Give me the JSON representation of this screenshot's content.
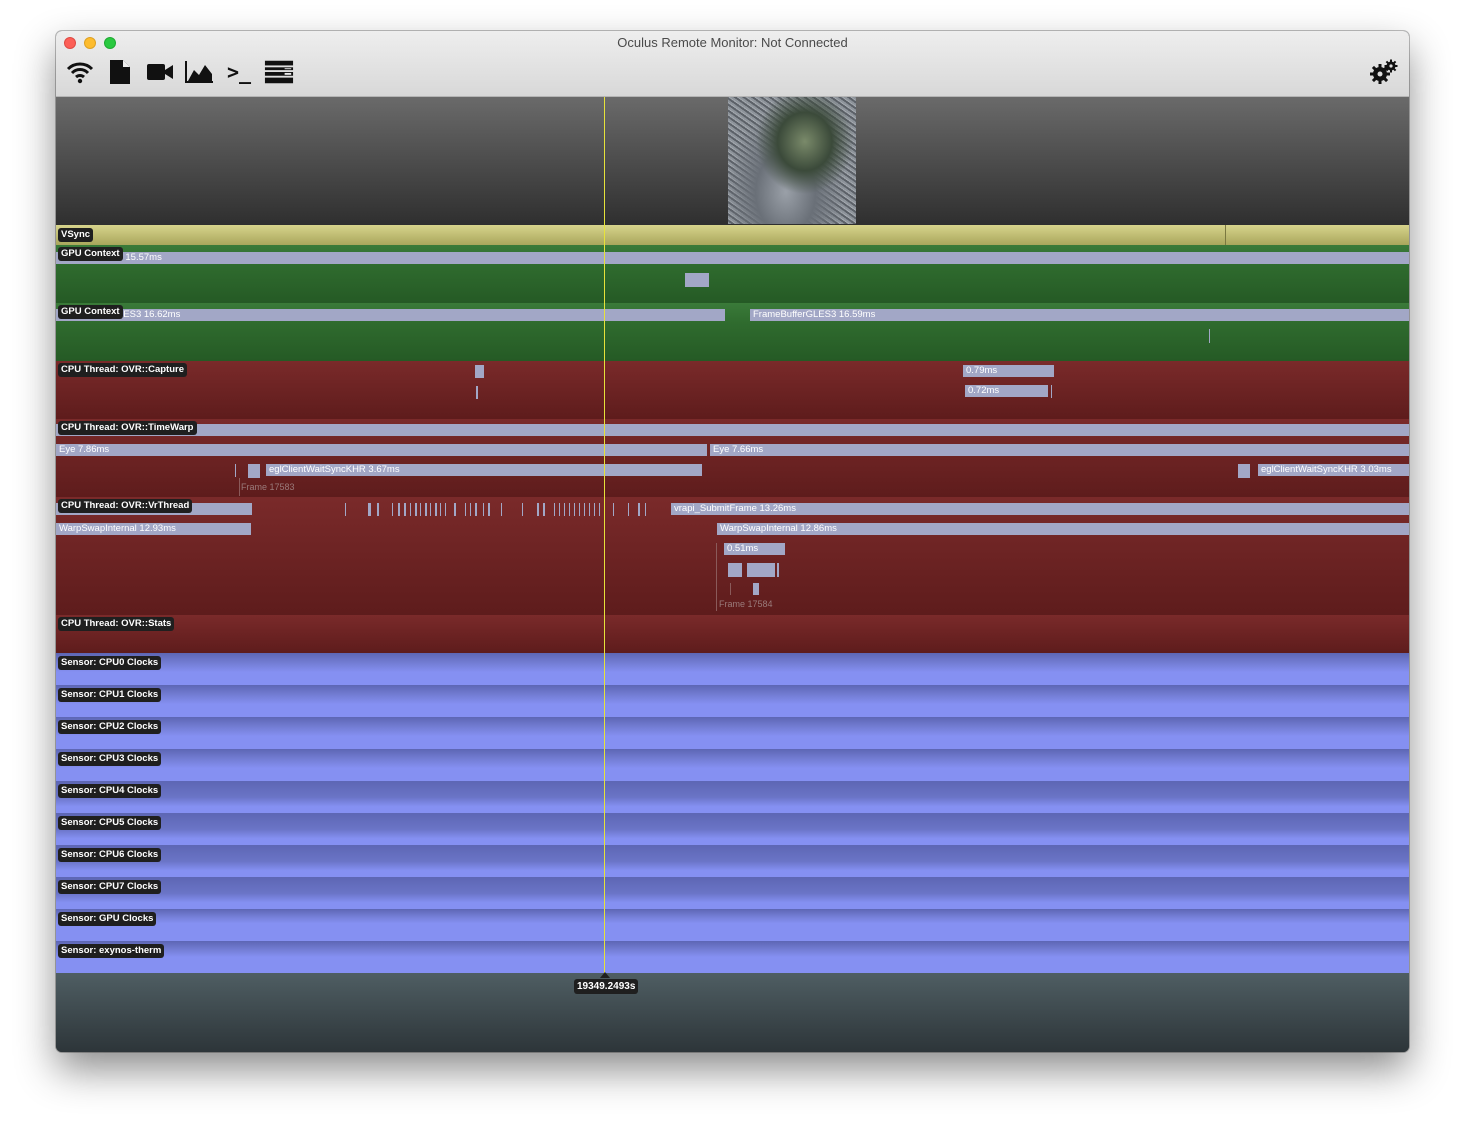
{
  "window": {
    "title": "Oculus Remote Monitor: Not Connected"
  },
  "toolbar": {
    "icons": [
      "wifi-icon",
      "document-icon",
      "video-camera-icon",
      "chart-area-icon",
      "terminal-icon",
      "list-panel-icon"
    ],
    "terminal_glyph": ">_",
    "settings_icon": "gears-icon"
  },
  "tracks": {
    "vsync": {
      "label": "VSync"
    },
    "gpu_context_1": {
      "label": "GPU Context",
      "bar": "s 15.57ms"
    },
    "gpu_context_2": {
      "label": "GPU Context",
      "bar1": "LES3 16.62ms",
      "bar2": "FrameBufferGLES3 16.59ms"
    },
    "capture": {
      "label": "CPU Thread: OVR::Capture",
      "bar1": "0.79ms",
      "bar2": "0.72ms"
    },
    "timewarp": {
      "label": "CPU Thread: OVR::TimeWarp",
      "eye1": "Eye 7.86ms",
      "eye2": "Eye 7.66ms",
      "egl1": "eglClientWaitSyncKHR 3.67ms",
      "egl2": "eglClientWaitSyncKHR 3.03ms",
      "frame": "Frame 17583"
    },
    "vrthread": {
      "label": "CPU Thread: OVR::VrThread",
      "submit": "vrapi_SubmitFrame 13.26ms",
      "warp1": "WarpSwapInternal 12.93ms",
      "warp2": "WarpSwapInternal 12.86ms",
      "small": "0.51ms",
      "frame": "Frame 17584"
    },
    "stats": {
      "label": "CPU Thread: OVR::Stats"
    },
    "sensors": [
      "Sensor: CPU0 Clocks",
      "Sensor: CPU1 Clocks",
      "Sensor: CPU2 Clocks",
      "Sensor: CPU3 Clocks",
      "Sensor: CPU4 Clocks",
      "Sensor: CPU5 Clocks",
      "Sensor: CPU6 Clocks",
      "Sensor: CPU7 Clocks",
      "Sensor: GPU Clocks",
      "Sensor: exynos-therm"
    ]
  },
  "cursor": {
    "time": "19349.2493s"
  },
  "colors": {
    "vsync": "#c9c67a",
    "gpu": "#2f6b2e",
    "cpu": "#6b2020",
    "sensor": "#8590f2",
    "bar": "#a2a7c6",
    "cursor": "#e6e23a"
  }
}
